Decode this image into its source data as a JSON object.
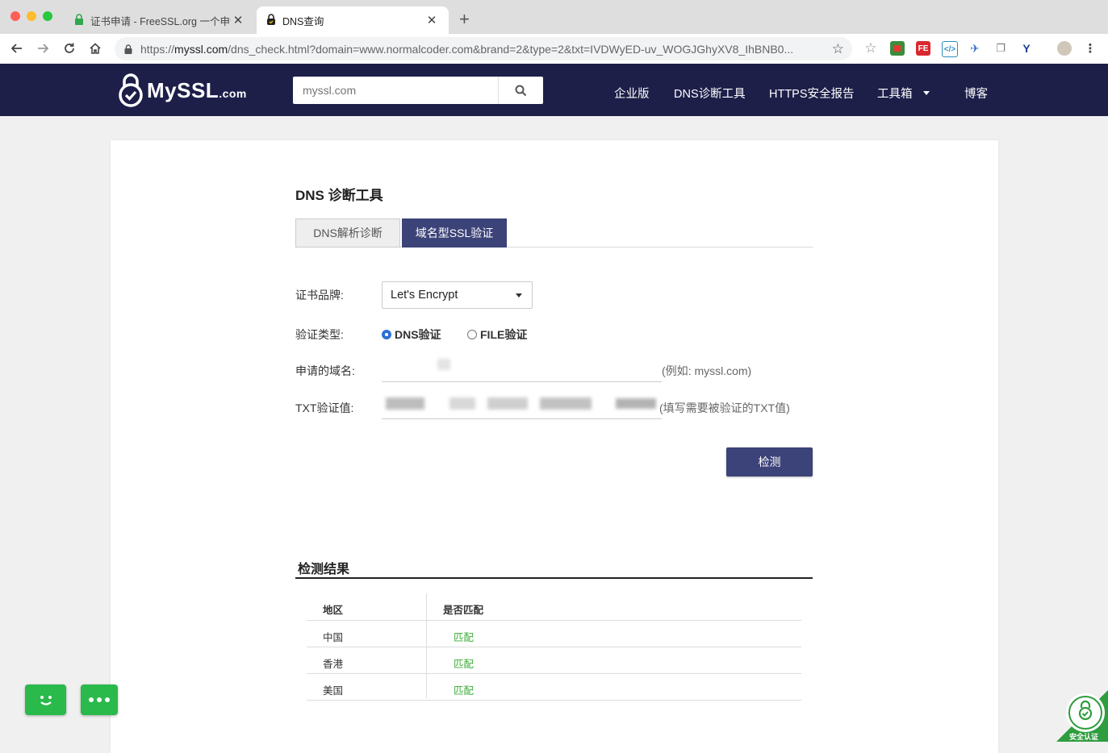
{
  "browser": {
    "tabs": [
      {
        "title": "证书申请 - FreeSSL.org 一个申请",
        "active": false
      },
      {
        "title": "DNS查询",
        "active": true
      }
    ],
    "url_prefix": "https://",
    "url_host": "myssl.com",
    "url_path": "/dns_check.html?domain=www.normalcoder.com&brand=2&type=2&txt=IVDWyED-uv_WOGJGhyXV8_IhBNB0..."
  },
  "site": {
    "logo_main": "MySSL",
    "logo_suffix": ".com",
    "search_placeholder": "myssl.com",
    "nav": [
      "企业版",
      "DNS诊断工具",
      "HTTPS安全报告",
      "工具箱",
      "博客"
    ]
  },
  "tool": {
    "title": "DNS 诊断工具",
    "tabs": [
      "DNS解析诊断",
      "域名型SSL验证"
    ],
    "active_tab": "域名型SSL验证",
    "brand_label": "证书品牌:",
    "brand_value": "Let's Encrypt",
    "type_label": "验证类型:",
    "type_options": [
      "DNS验证",
      "FILE验证"
    ],
    "type_selected": "DNS验证",
    "domain_label": "申请的域名:",
    "domain_hint": "(例如: myssl.com)",
    "txt_label": "TXT验证值:",
    "txt_hint": "(填写需要被验证的TXT值)",
    "check_button": "检测"
  },
  "results": {
    "title": "检测结果",
    "columns": [
      "地区",
      "是否匹配"
    ],
    "rows": [
      {
        "region": "中国",
        "match": "匹配"
      },
      {
        "region": "香港",
        "match": "匹配"
      },
      {
        "region": "美国",
        "match": "匹配"
      }
    ]
  },
  "badge_text": "安全认证",
  "colors": {
    "header_bg": "#1d1f49",
    "accent": "#3c4378",
    "match_green": "#3aaa35",
    "widget_green": "#2ab94b"
  }
}
